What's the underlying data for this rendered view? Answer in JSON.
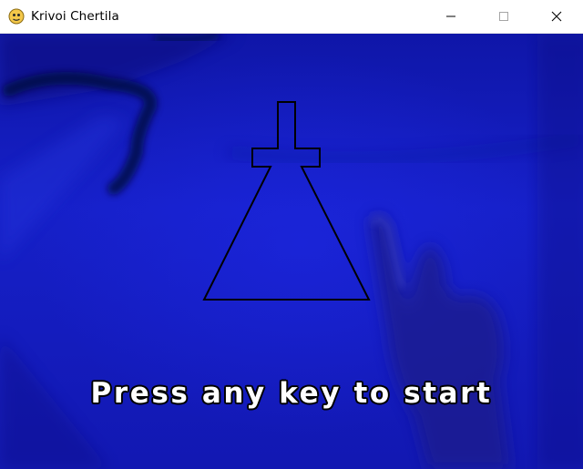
{
  "window": {
    "title": "Krivoi Chertila",
    "app_icon": "python-pygame-icon",
    "controls": {
      "minimize": "minimize-icon",
      "maximize": "maximize-icon",
      "close": "close-icon"
    }
  },
  "game": {
    "prompt": "Press any key to start",
    "target_shape": "flask-outline",
    "colors": {
      "background": "#1218b2",
      "outline": "#000000",
      "prompt_text": "#ffffff",
      "prompt_outline": "#000000"
    }
  }
}
